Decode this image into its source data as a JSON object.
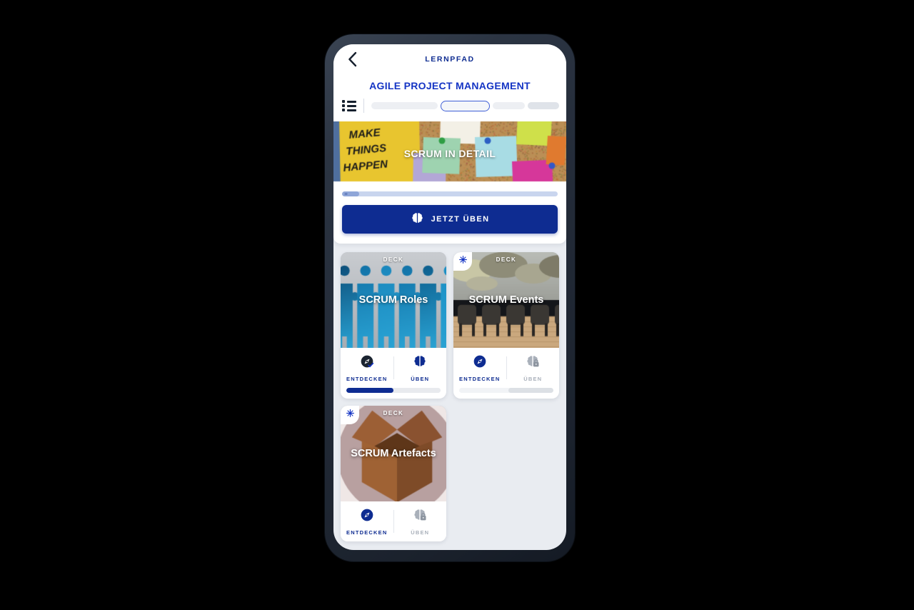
{
  "header": {
    "back_icon": "chevron-left-icon",
    "nav_title": "LERNPFAD",
    "page_title": "AGILE PROJECT MANAGEMENT",
    "list_icon": "list-icon"
  },
  "steps": {
    "segments": [
      {
        "state": "done"
      },
      {
        "state": "active"
      },
      {
        "state": "todo"
      },
      {
        "state": "dim"
      }
    ]
  },
  "hero": {
    "title": "SCRUM IN DETAIL",
    "sticky_note_text_line1": "MAKE",
    "sticky_note_text_line2": "THINGS",
    "sticky_note_text_line3": "HAPPEN",
    "progress_percent": 8
  },
  "practice": {
    "label": "JETZT ÜBEN",
    "icon": "brain-icon",
    "accent_color": "#0E2C91"
  },
  "colors": {
    "brand_blue": "#0E2C91",
    "title_blue": "#1434C4",
    "page_background": "#E9ECF1",
    "locked_grey": "#A9B0BA"
  },
  "decks": [
    {
      "kicker": "DECK",
      "name": "SCRUM Roles",
      "thumb": "puzzle-people",
      "new_badge": false,
      "badge_icon": "",
      "explore": {
        "label": "ENTDECKEN",
        "icon": "compass-check-icon",
        "state": "completed"
      },
      "practice": {
        "label": "ÜBEN",
        "icon": "brain-icon",
        "state": "available"
      },
      "progress_percent": 50,
      "progress_style": "blue"
    },
    {
      "kicker": "DECK",
      "name": "SCRUM Events",
      "thumb": "meeting-room",
      "new_badge": true,
      "badge_icon": "snowflake-icon",
      "explore": {
        "label": "ENTDECKEN",
        "icon": "compass-icon",
        "state": "available"
      },
      "practice": {
        "label": "ÜBEN",
        "icon": "brain-lock-icon",
        "state": "locked"
      },
      "progress_percent": 0,
      "progress_style": "grey"
    },
    {
      "kicker": "DECK",
      "name": "SCRUM Artefacts",
      "thumb": "open-box",
      "new_badge": true,
      "badge_icon": "snowflake-icon",
      "explore": {
        "label": "ENTDECKEN",
        "icon": "compass-icon",
        "state": "available"
      },
      "practice": {
        "label": "ÜBEN",
        "icon": "brain-lock-icon",
        "state": "locked"
      },
      "progress_percent": 0,
      "progress_style": "none"
    }
  ]
}
